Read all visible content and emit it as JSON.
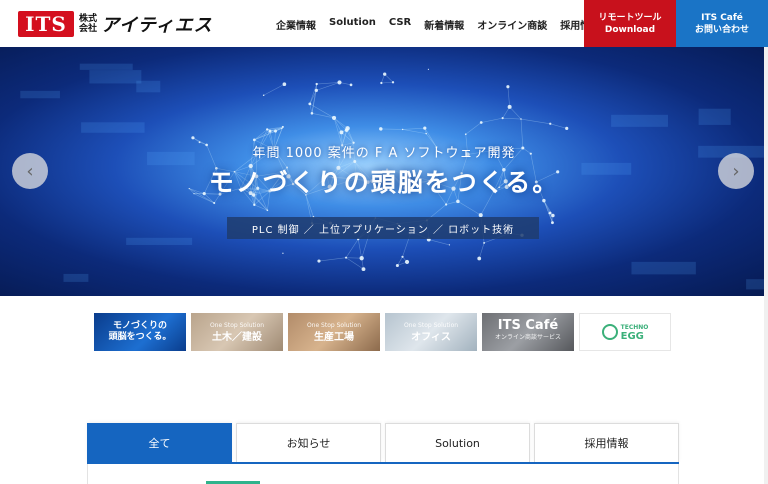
{
  "header": {
    "logo_mark": "ITS",
    "logo_kk_line1": "株式",
    "logo_kk_line2": "会社",
    "logo_name": "アイティエス",
    "nav": [
      {
        "label": "企業情報"
      },
      {
        "label": "Solution"
      },
      {
        "label": "CSR"
      },
      {
        "label": "新着情報"
      },
      {
        "label": "オンライン商談"
      },
      {
        "label": "採用情報"
      }
    ],
    "cta_remote": {
      "line1": "リモートツール",
      "line2": "Download"
    },
    "cta_cafe": {
      "line1": "ITS Café",
      "line2": "お問い合わせ"
    }
  },
  "hero": {
    "subtitle": "年間 1000 案件の F A ソフトウェア開発",
    "title": "モノづくりの頭脳をつくる。",
    "band": "PLC 制御 ／ 上位アプリケーション ／ ロボット技術",
    "prev_glyph": "‹",
    "next_glyph": "›"
  },
  "banners": [
    {
      "small": "",
      "line1": "モノづくりの",
      "line2": "頭脳をつくる。"
    },
    {
      "small": "One Stop Solution",
      "line1": "土木／建設",
      "line2": ""
    },
    {
      "small": "One Stop Solution",
      "line1": "生産工場",
      "line2": ""
    },
    {
      "small": "One Stop Solution",
      "line1": "オフィス",
      "line2": ""
    },
    {
      "small": "",
      "line1": "ITS Café",
      "line2": "オンライン商談サービス"
    },
    {
      "small": "TECHNO",
      "line1": "EGG",
      "line2": ""
    }
  ],
  "tabs": [
    {
      "label": "全て",
      "active": true
    },
    {
      "label": "お知らせ",
      "active": false
    },
    {
      "label": "Solution",
      "active": false
    },
    {
      "label": "採用情報",
      "active": false
    }
  ],
  "colors": {
    "brand_red": "#d40f1e",
    "cta_red": "#c8111c",
    "cta_blue": "#1a74c6",
    "tab_active": "#1565c0",
    "accent_green": "#2fb38c"
  }
}
